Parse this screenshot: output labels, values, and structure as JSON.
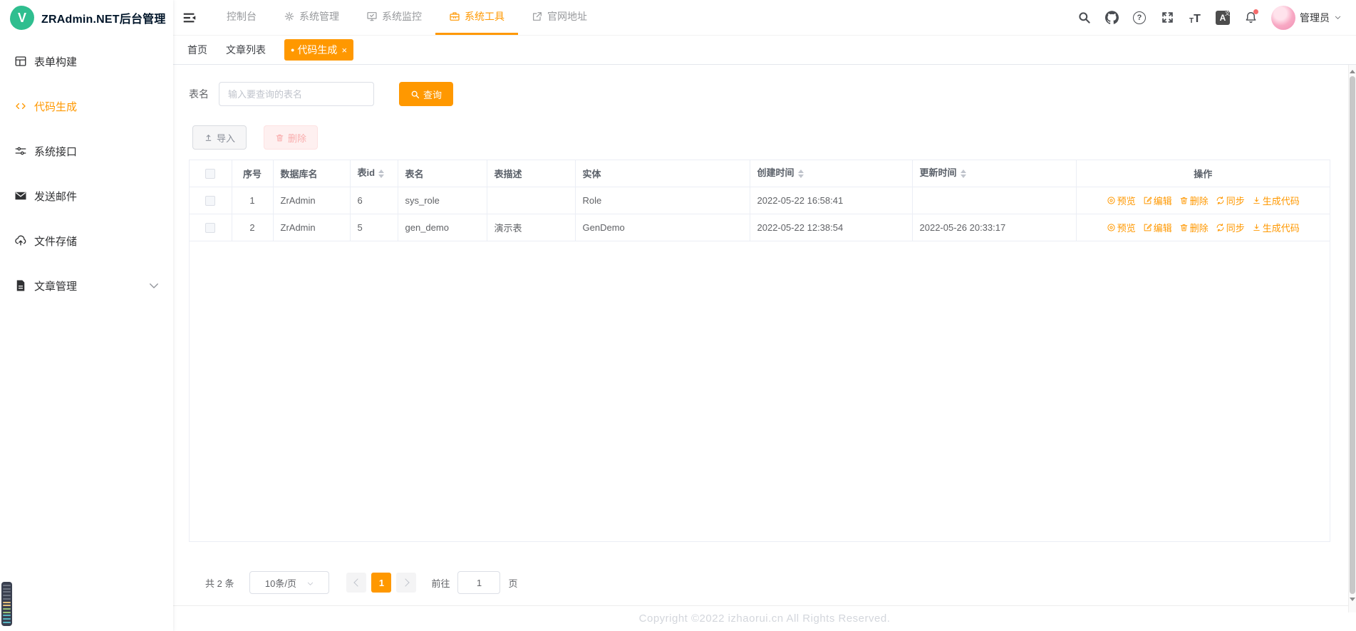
{
  "app": {
    "title": "ZRAdmin.NET后台管理"
  },
  "sidebar": {
    "logo_letter": "V",
    "logo_text": "ZRAdmin.NET后台管理",
    "items": [
      {
        "label": "表单构建",
        "icon": "form-grid-icon",
        "active": false
      },
      {
        "label": "代码生成",
        "icon": "code-icon",
        "active": true
      },
      {
        "label": "系统接口",
        "icon": "sliders-icon",
        "active": false
      },
      {
        "label": "发送邮件",
        "icon": "mail-icon",
        "active": false
      },
      {
        "label": "文件存储",
        "icon": "cloud-upload-icon",
        "active": false
      },
      {
        "label": "文章管理",
        "icon": "document-icon",
        "active": false,
        "expandable": true
      }
    ]
  },
  "topnav": {
    "items": [
      {
        "label": "控制台",
        "icon": null,
        "active": false
      },
      {
        "label": "系统管理",
        "icon": "gear-icon",
        "active": false
      },
      {
        "label": "系统监控",
        "icon": "monitor-icon",
        "active": false
      },
      {
        "label": "系统工具",
        "icon": "toolbox-icon",
        "active": true
      },
      {
        "label": "官网地址",
        "icon": "external-link-icon",
        "active": false
      }
    ],
    "right_icons": [
      "search-icon",
      "github-icon",
      "help-icon",
      "fullscreen-icon",
      "font-size-icon",
      "translate-icon",
      "bell-icon"
    ],
    "user": {
      "name": "管理员"
    }
  },
  "ui": {
    "tab_dot": "●",
    "tab_close": "×",
    "help_glyph": "?",
    "fontsize_glyph": "T",
    "translate_main": "A",
    "translate_sub": "文"
  },
  "tabs": [
    {
      "label": "首页",
      "active": false
    },
    {
      "label": "文章列表",
      "active": false
    },
    {
      "label": "代码生成",
      "active": true,
      "closable": true
    }
  ],
  "search": {
    "label": "表名",
    "placeholder": "输入要查询的表名",
    "value": "",
    "query_button": "查询"
  },
  "toolbar": {
    "import_label": "导入",
    "delete_label": "删除"
  },
  "table": {
    "columns": [
      "序号",
      "数据库名",
      "表id",
      "表名",
      "表描述",
      "实体",
      "创建时间",
      "更新时间",
      "操作"
    ],
    "sortable_columns": [
      "表id",
      "创建时间",
      "更新时间"
    ],
    "rows": [
      {
        "index": "1",
        "db": "ZrAdmin",
        "table_id": "6",
        "name": "sys_role",
        "desc": "",
        "entity": "Role",
        "created": "2022-05-22 16:58:41",
        "updated": ""
      },
      {
        "index": "2",
        "db": "ZrAdmin",
        "table_id": "5",
        "name": "gen_demo",
        "desc": "演示表",
        "entity": "GenDemo",
        "created": "2022-05-22 12:38:54",
        "updated": "2022-05-26 20:33:17"
      }
    ],
    "actions": [
      "预览",
      "编辑",
      "删除",
      "同步",
      "生成代码"
    ]
  },
  "pagination": {
    "total_text": "共 2 条",
    "page_size": "10条/页",
    "current_page": "1",
    "goto_label": "前往",
    "goto_value": "1",
    "page_suffix": "页"
  },
  "footer": {
    "copyright": "Copyright ©2022 izhaorui.cn All Rights Reserved."
  },
  "colors": {
    "accent": "#ff9800",
    "logo_green": "#2fbe8f",
    "danger_light_bg": "#fef0f0",
    "danger_light_text": "#f9aeae",
    "notification_dot": "#f56c6c"
  }
}
